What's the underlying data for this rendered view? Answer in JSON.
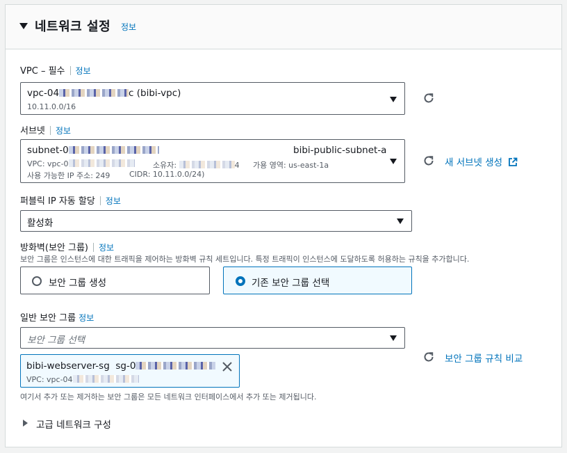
{
  "section": {
    "title": "네트워크 설정",
    "info": "정보"
  },
  "vpc": {
    "label": "VPC – 필수",
    "info": "정보",
    "value_prefix": "vpc-04",
    "value_suffix": "c (bibi-vpc)",
    "cidr": "10.11.0.0/16"
  },
  "subnet": {
    "label": "서브넷",
    "info": "정보",
    "value_prefix": "subnet-0",
    "name": "bibi-public-subnet-a",
    "vpc_prefix": "VPC: vpc-0",
    "owner_label": "소유자:",
    "owner_suffix": "4",
    "az": "가용 영역: us-east-1a",
    "available_ip": "사용 가능한 IP 주소: 249",
    "cidr": "CIDR: 10.11.0.0/24)",
    "create_link": "새 서브넷 생성"
  },
  "public_ip": {
    "label": "퍼블릭 IP 자동 할당",
    "info": "정보",
    "value": "활성화"
  },
  "firewall": {
    "label": "방화벽(보안 그룹)",
    "info": "정보",
    "description": "보안 그룹은 인스턴스에 대한 트래픽을 제어하는 방화벽 규칙 세트입니다. 특정 트래픽이 인스턴스에 도달하도록 허용하는 규칙을 추가합니다.",
    "options": [
      {
        "label": "보안 그룹 생성",
        "selected": false
      },
      {
        "label": "기존 보안 그룹 선택",
        "selected": true
      }
    ]
  },
  "security_groups": {
    "label": "일반 보안 그룹",
    "info": "정보",
    "placeholder": "보안 그룹 선택",
    "compare_link": "보안 그룹 규칙 비교",
    "token": {
      "name": "bibi-webserver-sg",
      "id_prefix": "sg-0",
      "vpc_prefix": "VPC: vpc-04"
    },
    "help": "여기서 추가 또는 제거하는 보안 그룹은 모든 네트워크 인터페이스에서 추가 또는 제거됩니다."
  },
  "advanced": {
    "label": "고급 네트워크 구성"
  },
  "colors": {
    "link": "#0073bb",
    "border": "#545b64",
    "selected_bg": "#f1faff"
  },
  "icons": [
    "caret-down-icon",
    "dropdown-arrow-icon",
    "refresh-icon",
    "external-link-icon",
    "close-icon",
    "caret-right-icon"
  ]
}
